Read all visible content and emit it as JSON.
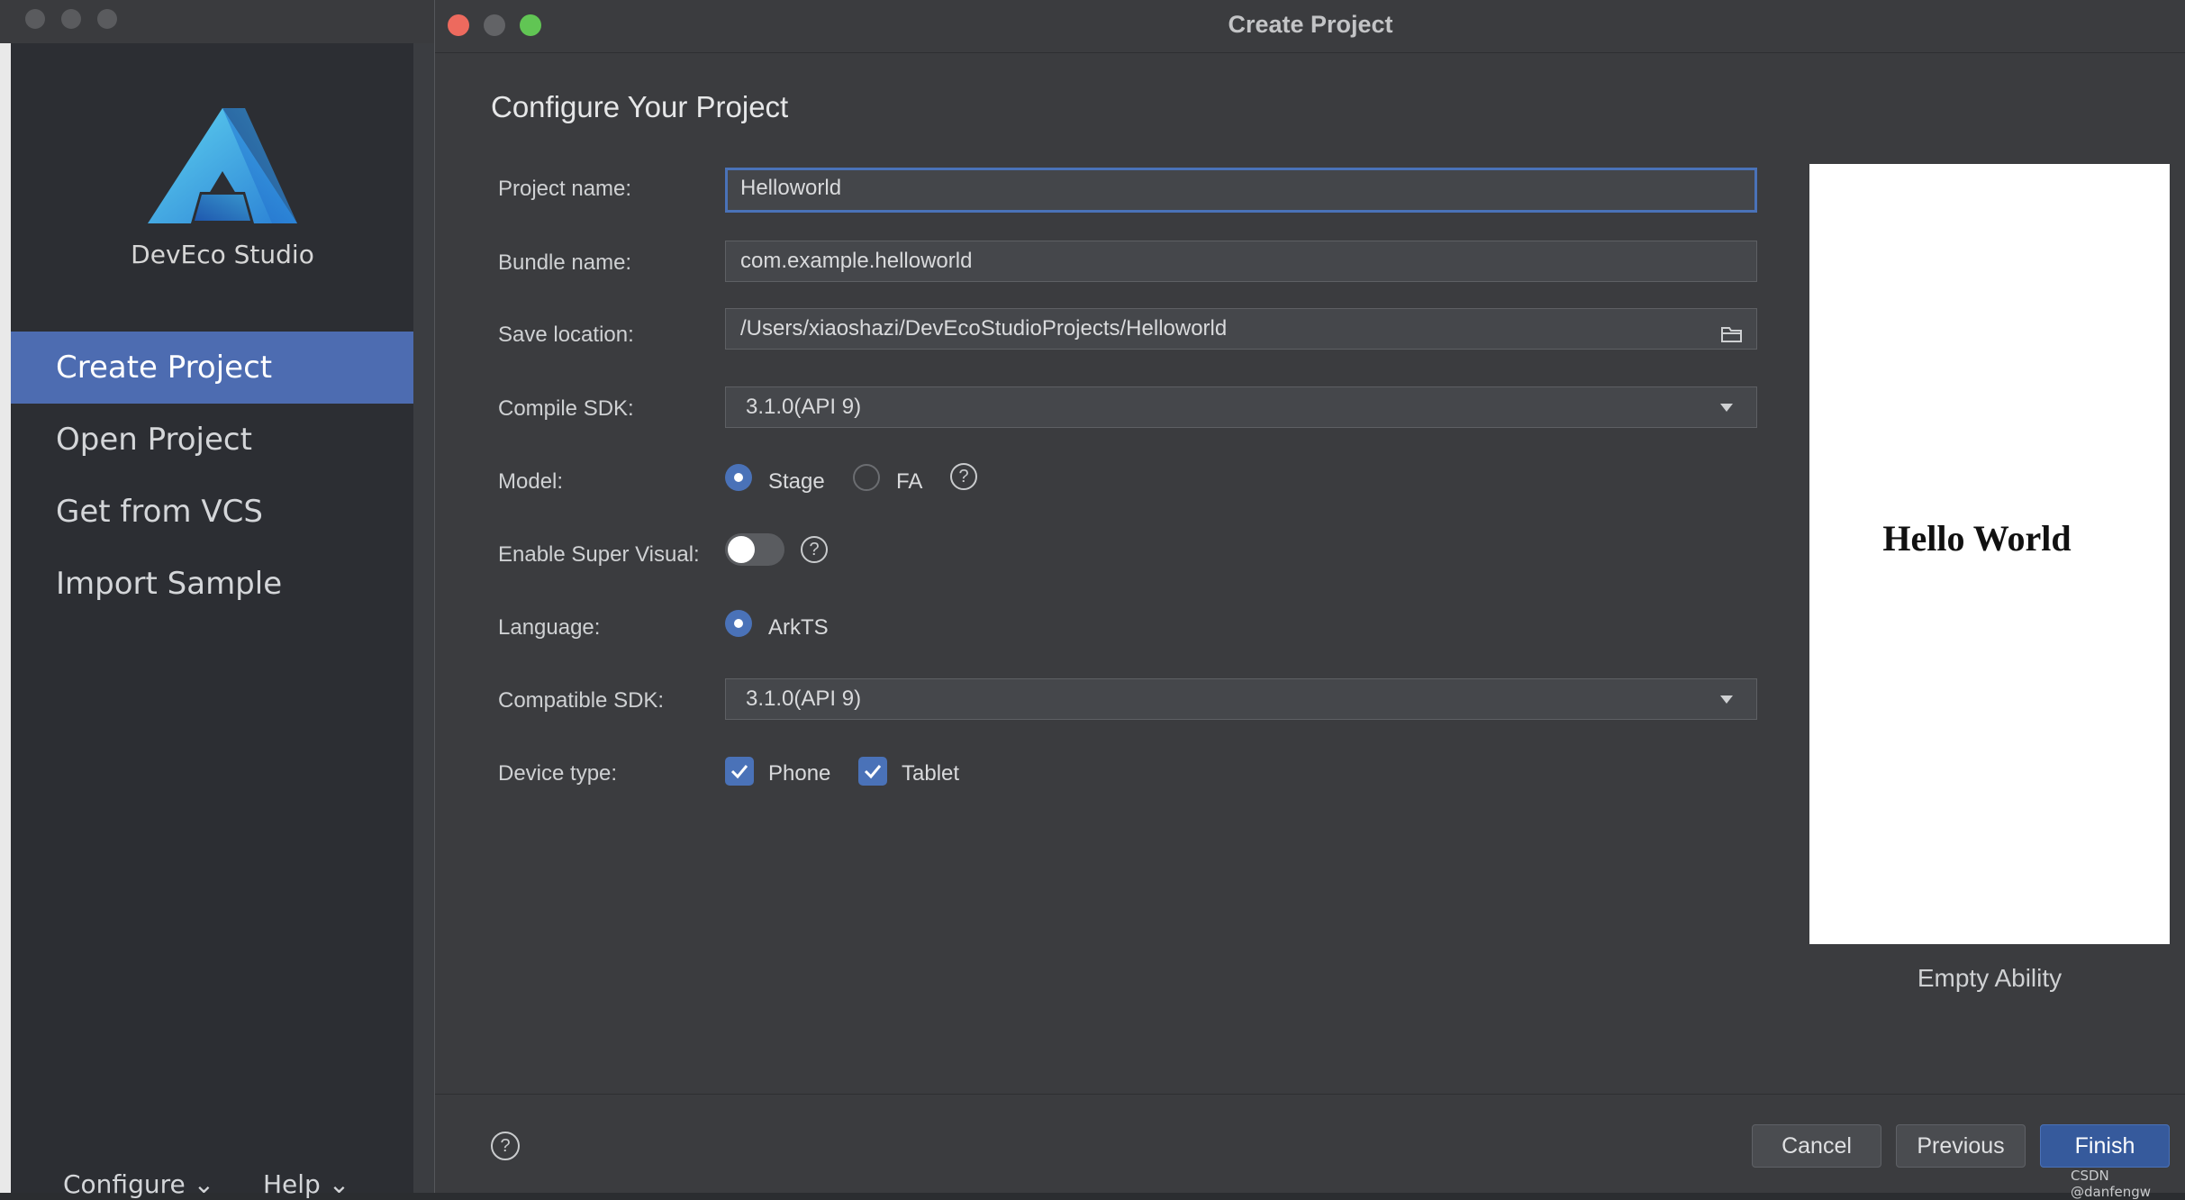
{
  "welcome": {
    "brand": "DevEco Studio",
    "nav": [
      {
        "label": "Create Project"
      },
      {
        "label": "Open Project"
      },
      {
        "label": "Get from VCS"
      },
      {
        "label": "Import Sample"
      }
    ],
    "footer": {
      "configure": "Configure",
      "help": "Help"
    }
  },
  "dialog": {
    "title": "Create Project",
    "section_title": "Configure Your Project",
    "fields": {
      "project_name": {
        "label": "Project name:",
        "value": "Helloworld"
      },
      "bundle_name": {
        "label": "Bundle name:",
        "value": "com.example.helloworld"
      },
      "save_location": {
        "label": "Save location:",
        "value": "/Users/xiaoshazi/DevEcoStudioProjects/Helloworld"
      },
      "compile_sdk": {
        "label": "Compile SDK:",
        "value": "3.1.0(API 9)"
      },
      "model": {
        "label": "Model:",
        "options": [
          "Stage",
          "FA"
        ],
        "selected": "Stage"
      },
      "super_visual": {
        "label": "Enable Super Visual:",
        "enabled": false
      },
      "language": {
        "label": "Language:",
        "value": "ArkTS"
      },
      "compatible_sdk": {
        "label": "Compatible SDK:",
        "value": "3.1.0(API 9)"
      },
      "device_type": {
        "label": "Device type:",
        "options": [
          {
            "label": "Phone",
            "checked": true
          },
          {
            "label": "Tablet",
            "checked": true
          }
        ]
      }
    },
    "preview": {
      "text": "Hello World",
      "caption": "Empty Ability"
    },
    "buttons": {
      "cancel": "Cancel",
      "previous": "Previous",
      "finish": "Finish"
    },
    "help_symbol": "?"
  },
  "watermark": "CSDN @danfengw",
  "colors": {
    "accent": "#4a72b8",
    "nav_active": "#4d6cb1",
    "close": "#ed6a5e",
    "zoom": "#61c554"
  }
}
